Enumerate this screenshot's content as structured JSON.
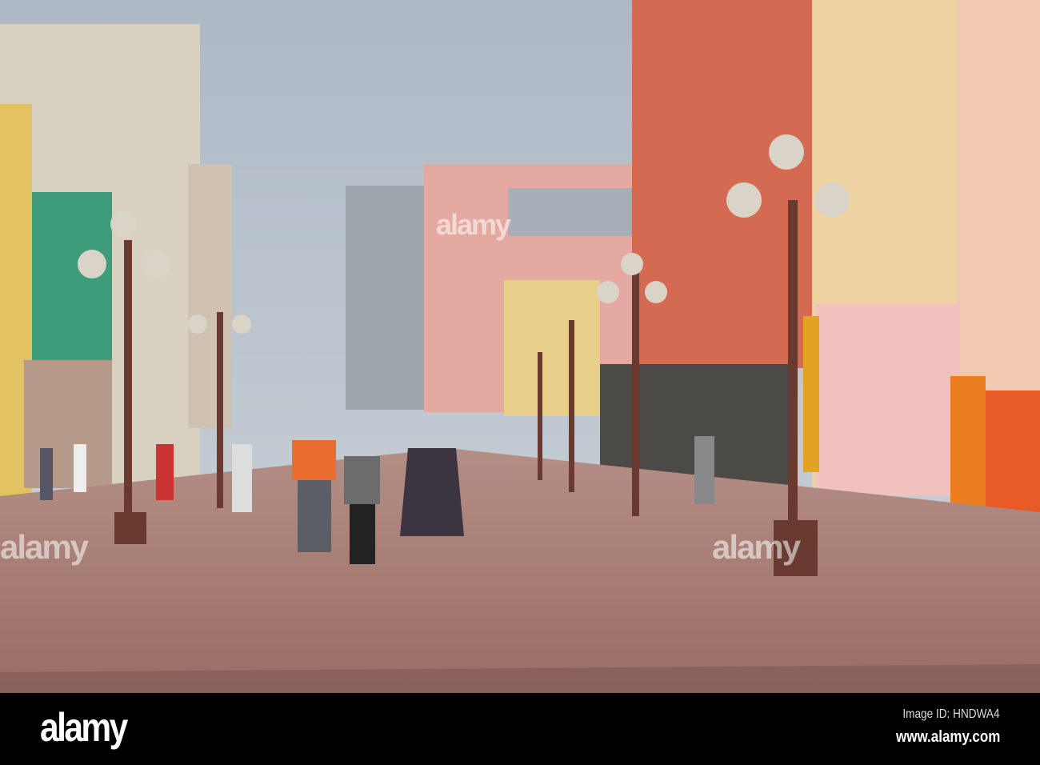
{
  "scene": "pedestrian street with historic facades and street lamps",
  "watermark": "alamy",
  "footer": {
    "logo": "alamy",
    "image_id": "Image ID: HNDWA4",
    "url": "www.alamy.com"
  },
  "colors": {
    "sky": "#b9c4cf",
    "pavement": "#a8766c",
    "footer": "#000000"
  }
}
